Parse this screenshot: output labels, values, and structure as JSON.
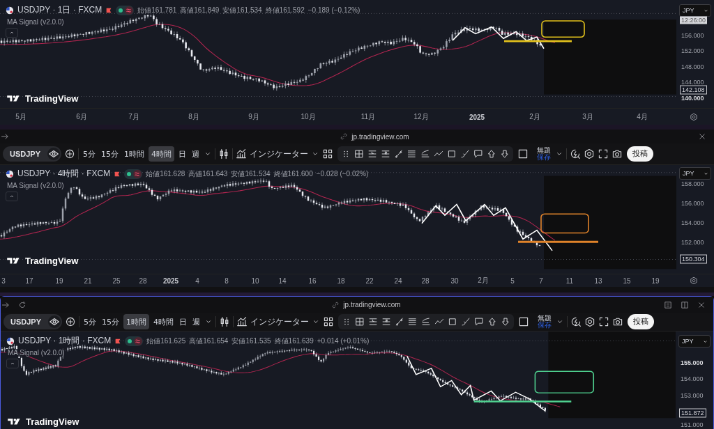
{
  "panels": [
    {
      "legend": {
        "title": "USDJPY · 1日 · FXCM",
        "ohlc": [
          {
            "label": "始値",
            "value": "161.781"
          },
          {
            "label": "高値",
            "value": "161.849"
          },
          {
            "label": "安値",
            "value": "161.534"
          },
          {
            "label": "終値",
            "value": "161.592"
          }
        ],
        "change": "−0.189 (−0.12%)"
      },
      "indicator": "MA Signal (v2.0.0)",
      "logo": "TradingView",
      "currency": "JPY",
      "price_labels": [
        {
          "text": "12:26:00",
          "kind": "time"
        },
        {
          "text": "156.000",
          "kind": "tick"
        },
        {
          "text": "152.000",
          "kind": "tick"
        },
        {
          "text": "148.000",
          "kind": "tick"
        },
        {
          "text": "144.000",
          "kind": "tick"
        },
        {
          "text": "142.108",
          "kind": "last"
        },
        {
          "text": "140.000",
          "kind": "major"
        }
      ],
      "time_labels": [
        {
          "text": "5月",
          "kind": "month"
        },
        {
          "text": "6月",
          "kind": "month"
        },
        {
          "text": "7月",
          "kind": "month"
        },
        {
          "text": "8月",
          "kind": "month"
        },
        {
          "text": "9月",
          "kind": "month"
        },
        {
          "text": "10月",
          "kind": "month"
        },
        {
          "text": "11月",
          "kind": "month"
        },
        {
          "text": "12月",
          "kind": "month"
        },
        {
          "text": "2025",
          "kind": "year"
        },
        {
          "text": "2月",
          "kind": "month"
        },
        {
          "text": "3月",
          "kind": "month"
        },
        {
          "text": "4月",
          "kind": "month"
        }
      ],
      "annotation": {
        "color": "#e3c21c"
      }
    },
    {
      "window": {
        "kind": "basic",
        "focused": false,
        "url": "jp.tradingview.com"
      },
      "toolbar": {
        "symbol": "USDJPY",
        "intervals": [
          {
            "label": "5分",
            "selected": false
          },
          {
            "label": "15分",
            "selected": false
          },
          {
            "label": "1時間",
            "selected": false
          },
          {
            "label": "4時間",
            "selected": true
          },
          {
            "label": "日",
            "selected": false
          },
          {
            "label": "週",
            "selected": false
          }
        ],
        "indicators": "インジケーター",
        "layout_title": "無題",
        "save": "保存",
        "post": "投稿"
      },
      "legend": {
        "title": "USDJPY · 4時間 · FXCM",
        "ohlc": [
          {
            "label": "始値",
            "value": "161.628"
          },
          {
            "label": "高値",
            "value": "161.643"
          },
          {
            "label": "安値",
            "value": "161.534"
          },
          {
            "label": "終値",
            "value": "161.600"
          }
        ],
        "change": "−0.028 (−0.02%)"
      },
      "indicator": "MA Signal (v2.0.0)",
      "logo": "TradingView",
      "currency": "JPY",
      "price_labels": [
        {
          "text": "158.000",
          "kind": "tick"
        },
        {
          "text": "156.000",
          "kind": "tick"
        },
        {
          "text": "154.000",
          "kind": "tick"
        },
        {
          "text": "152.000",
          "kind": "tick"
        },
        {
          "text": "150.304",
          "kind": "last"
        }
      ],
      "time_labels": [
        {
          "text": "3",
          "kind": "day"
        },
        {
          "text": "17",
          "kind": "day"
        },
        {
          "text": "19",
          "kind": "day"
        },
        {
          "text": "21",
          "kind": "day"
        },
        {
          "text": "25",
          "kind": "day"
        },
        {
          "text": "28",
          "kind": "day"
        },
        {
          "text": "2025",
          "kind": "year"
        },
        {
          "text": "4",
          "kind": "day"
        },
        {
          "text": "8",
          "kind": "day"
        },
        {
          "text": "10",
          "kind": "day"
        },
        {
          "text": "14",
          "kind": "day"
        },
        {
          "text": "16",
          "kind": "day"
        },
        {
          "text": "18",
          "kind": "day"
        },
        {
          "text": "22",
          "kind": "day"
        },
        {
          "text": "24",
          "kind": "day"
        },
        {
          "text": "28",
          "kind": "day"
        },
        {
          "text": "30",
          "kind": "day"
        },
        {
          "text": "2月",
          "kind": "month"
        },
        {
          "text": "5",
          "kind": "day"
        },
        {
          "text": "7",
          "kind": "day"
        },
        {
          "text": "11",
          "kind": "day"
        },
        {
          "text": "13",
          "kind": "day"
        },
        {
          "text": "15",
          "kind": "day"
        },
        {
          "text": "19",
          "kind": "day"
        }
      ],
      "annotation": {
        "color": "#e0832a"
      }
    },
    {
      "window": {
        "kind": "full",
        "focused": true,
        "url": "jp.tradingview.com"
      },
      "toolbar": {
        "symbol": "USDJPY",
        "intervals": [
          {
            "label": "5分",
            "selected": false
          },
          {
            "label": "15分",
            "selected": false
          },
          {
            "label": "1時間",
            "selected": true
          },
          {
            "label": "4時間",
            "selected": false
          },
          {
            "label": "日",
            "selected": false
          },
          {
            "label": "週",
            "selected": false
          }
        ],
        "indicators": "インジケーター",
        "layout_title": "無題",
        "save": "保存",
        "post": "投稿"
      },
      "legend": {
        "title": "USDJPY · 1時間 · FXCM",
        "ohlc": [
          {
            "label": "始値",
            "value": "161.625"
          },
          {
            "label": "高値",
            "value": "161.654"
          },
          {
            "label": "安値",
            "value": "161.535"
          },
          {
            "label": "終値",
            "value": "161.639"
          }
        ],
        "change": "+0.014 (+0.01%)"
      },
      "indicator": "MA Signal (v2.0.0)",
      "logo": "TradingView",
      "currency": "JPY",
      "price_labels": [
        {
          "text": "155.000",
          "kind": "major"
        },
        {
          "text": "154.000",
          "kind": "tick"
        },
        {
          "text": "153.000",
          "kind": "tick"
        },
        {
          "text": "151.872",
          "kind": "last"
        },
        {
          "text": "151.000",
          "kind": "tick"
        }
      ],
      "annotation": {
        "color": "#4fd08f"
      }
    }
  ]
}
